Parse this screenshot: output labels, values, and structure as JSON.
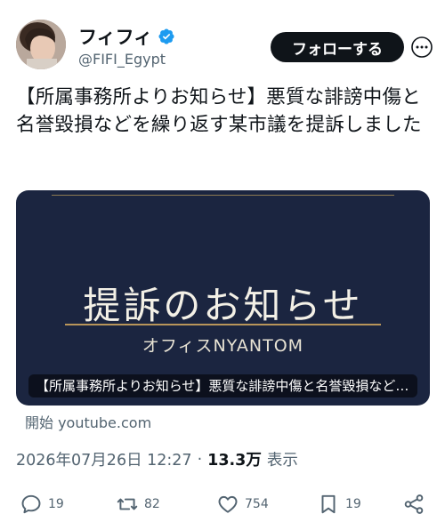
{
  "author": {
    "name": "フィフィ",
    "handle": "@FIFI_Egypt",
    "verified": true
  },
  "follow_label": "フォローする",
  "tweet_text": "【所属事務所よりお知らせ】悪質な誹謗中傷と名誉毀損などを繰り返す某市議を提訴しました",
  "card": {
    "title": "提訴のお知らせ",
    "subtitle": "オフィスNYANTOM",
    "caption": "【所属事務所よりお知らせ】悪質な誹謗中傷と名誉毀損などを繰り返す某市議を提訴しました",
    "source": "開始 youtube.com"
  },
  "meta": {
    "timestamp": "2026年07月26日 12:27",
    "views_count": "13.3万",
    "views_label": "表示"
  },
  "actions": {
    "reply": "19",
    "retweet": "82",
    "like": "754",
    "bookmark": "19"
  },
  "colors": {
    "verified": "#1d9bf0",
    "button_bg": "#0f1419",
    "card_bg": "#1b2540",
    "card_accent": "#b8955a"
  }
}
